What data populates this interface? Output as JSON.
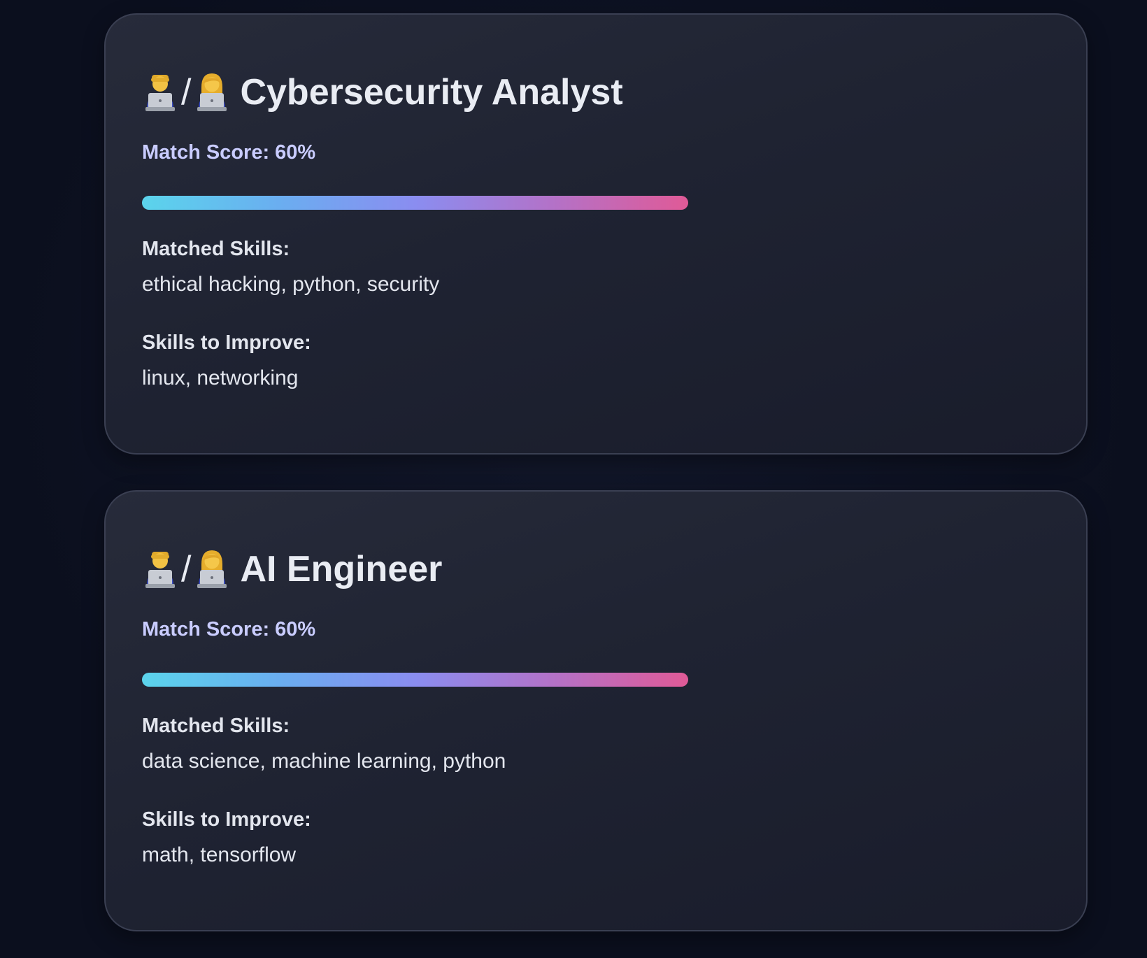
{
  "cards": [
    {
      "title": "Cybersecurity Analyst",
      "slash": "/",
      "icons": [
        "man-technologist-icon",
        "woman-technologist-icon"
      ],
      "match_score_text": "Match Score: 60%",
      "match_score": 0.6,
      "matched_label": "Matched Skills:",
      "matched_skills": "ethical hacking, python, security",
      "improve_label": "Skills to Improve:",
      "improve_skills": "linux, networking"
    },
    {
      "title": "AI Engineer",
      "slash": "/",
      "icons": [
        "man-technologist-icon",
        "woman-technologist-icon"
      ],
      "match_score_text": "Match Score: 60%",
      "match_score": 0.6,
      "matched_label": "Matched Skills:",
      "matched_skills": "data science, machine learning, python",
      "improve_label": "Skills to Improve:",
      "improve_skills": "math, tensorflow"
    }
  ],
  "colors": {
    "page_bg": "#0b0f1e",
    "card_bg": "#232737",
    "score_text": "#c9ccff",
    "bar_gradient_start": "#5bd4ec",
    "bar_gradient_mid": "#8a8df0",
    "bar_gradient_end": "#e05a97"
  }
}
